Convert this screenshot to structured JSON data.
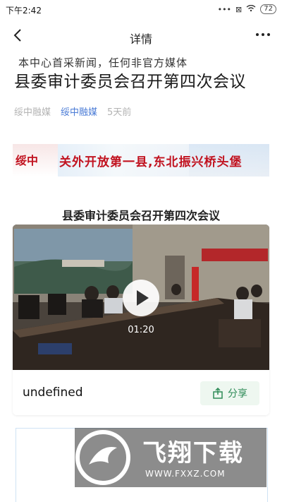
{
  "status_bar": {
    "time": "下午2:42",
    "icons": [
      "dots-icon",
      "sim-x-icon",
      "wifi-icon"
    ],
    "battery": "72"
  },
  "nav": {
    "title": "详情"
  },
  "article": {
    "title": "县委审计委员会召开第四次会议",
    "source_plain": "绥中融媒",
    "source_link": "绥中融媒",
    "time": "5天前"
  },
  "banner": {
    "mark": "绥中",
    "slogan": "关外开放第一县,东北振兴桥头堡"
  },
  "video": {
    "title": "县委审计委员会召开第四次会议",
    "duration": "01:20",
    "caption": "undefined",
    "share_label": "分享"
  },
  "notice": {
    "text": "本中心首采新闻，任何非官方媒体"
  },
  "watermark": {
    "title": "飞翔下载",
    "url": "WWW.FXXZ.COM"
  },
  "colors": {
    "accent_blue": "#4a7bd6",
    "share_green": "#2e8b57",
    "banner_red": "#c1121f"
  }
}
